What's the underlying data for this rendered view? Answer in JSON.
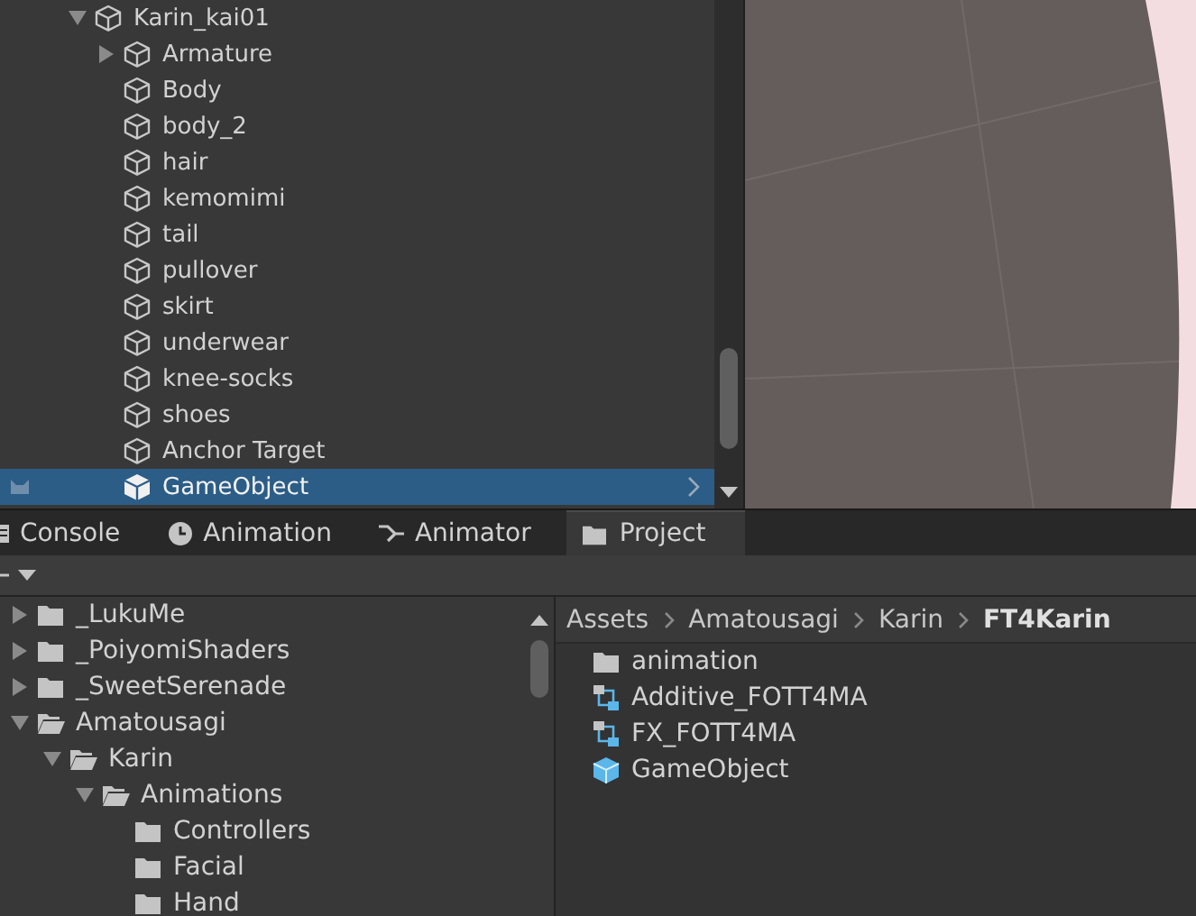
{
  "hierarchy": {
    "items": [
      {
        "label": "Karin_kai01",
        "kind": "parent",
        "expanded": true,
        "selected": false,
        "children": [
          {
            "label": "Armature",
            "kind": "parent",
            "expanded": false,
            "selected": false
          },
          {
            "label": "Body",
            "kind": "leaf",
            "selected": false
          },
          {
            "label": "body_2",
            "kind": "leaf",
            "selected": false
          },
          {
            "label": "hair",
            "kind": "leaf",
            "selected": false
          },
          {
            "label": "kemomimi",
            "kind": "leaf",
            "selected": false
          },
          {
            "label": "tail",
            "kind": "leaf",
            "selected": false
          },
          {
            "label": "pullover",
            "kind": "leaf",
            "selected": false
          },
          {
            "label": "skirt",
            "kind": "leaf",
            "selected": false
          },
          {
            "label": "underwear",
            "kind": "leaf",
            "selected": false
          },
          {
            "label": "knee-socks",
            "kind": "leaf",
            "selected": false
          },
          {
            "label": "shoes",
            "kind": "leaf",
            "selected": false
          },
          {
            "label": "Anchor Target",
            "kind": "leaf",
            "selected": false
          },
          {
            "label": "GameObject",
            "kind": "leaf",
            "selected": true
          }
        ]
      }
    ]
  },
  "tabs": [
    {
      "label": "Console",
      "selected": false
    },
    {
      "label": "Animation",
      "selected": false
    },
    {
      "label": "Animator",
      "selected": false
    },
    {
      "label": "Project",
      "selected": true
    }
  ],
  "project_tree": {
    "items": [
      {
        "label": "_LukuMe",
        "kind": "parent",
        "expanded": false
      },
      {
        "label": "_PoiyomiShaders",
        "kind": "parent",
        "expanded": false
      },
      {
        "label": "_SweetSerenade",
        "kind": "parent",
        "expanded": false
      },
      {
        "label": "Amatousagi",
        "kind": "parent",
        "expanded": true,
        "children": [
          {
            "label": "Karin",
            "kind": "parent",
            "expanded": true,
            "children": [
              {
                "label": "Animations",
                "kind": "parent",
                "expanded": true,
                "children": [
                  {
                    "label": "Controllers",
                    "kind": "leaf"
                  },
                  {
                    "label": "Facial",
                    "kind": "leaf"
                  },
                  {
                    "label": "Hand",
                    "kind": "leaf"
                  }
                ]
              }
            ]
          }
        ]
      }
    ]
  },
  "breadcrumb": [
    "Assets",
    "Amatousagi",
    "Karin",
    "FT4Karin"
  ],
  "assets": [
    {
      "label": "animation",
      "kind": "folder"
    },
    {
      "label": "Additive_FOTT4MA",
      "kind": "controller"
    },
    {
      "label": "FX_FOTT4MA",
      "kind": "controller"
    },
    {
      "label": "GameObject",
      "kind": "prefab"
    }
  ]
}
